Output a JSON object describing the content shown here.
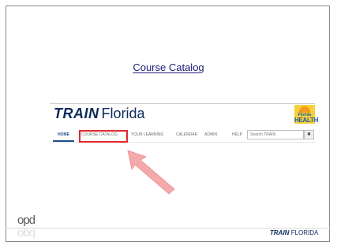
{
  "slide": {
    "title": "Course Catalog"
  },
  "site": {
    "logo_train": "TRAIN",
    "logo_florida": "Florida",
    "partner_logo_line1": "Florida",
    "partner_logo_line2": "HEALTH",
    "nav": {
      "home": "HOME",
      "course_catalog": "COURSE CATALOG",
      "your_learning": "YOUR LEARNING",
      "calendar": "CALENDAR",
      "admin": "ADMIN",
      "help": "HELP"
    },
    "search": {
      "placeholder": "Search TRAIN",
      "button_icon": "close-icon",
      "button_glyph": "✖"
    }
  },
  "annotation": {
    "highlight_color": "#e0292b",
    "arrow_color": "#f2a5a5"
  },
  "footer": {
    "left_logo": "opd",
    "brand_train": "TRAIN",
    "brand_florida": "FLORIDA"
  }
}
